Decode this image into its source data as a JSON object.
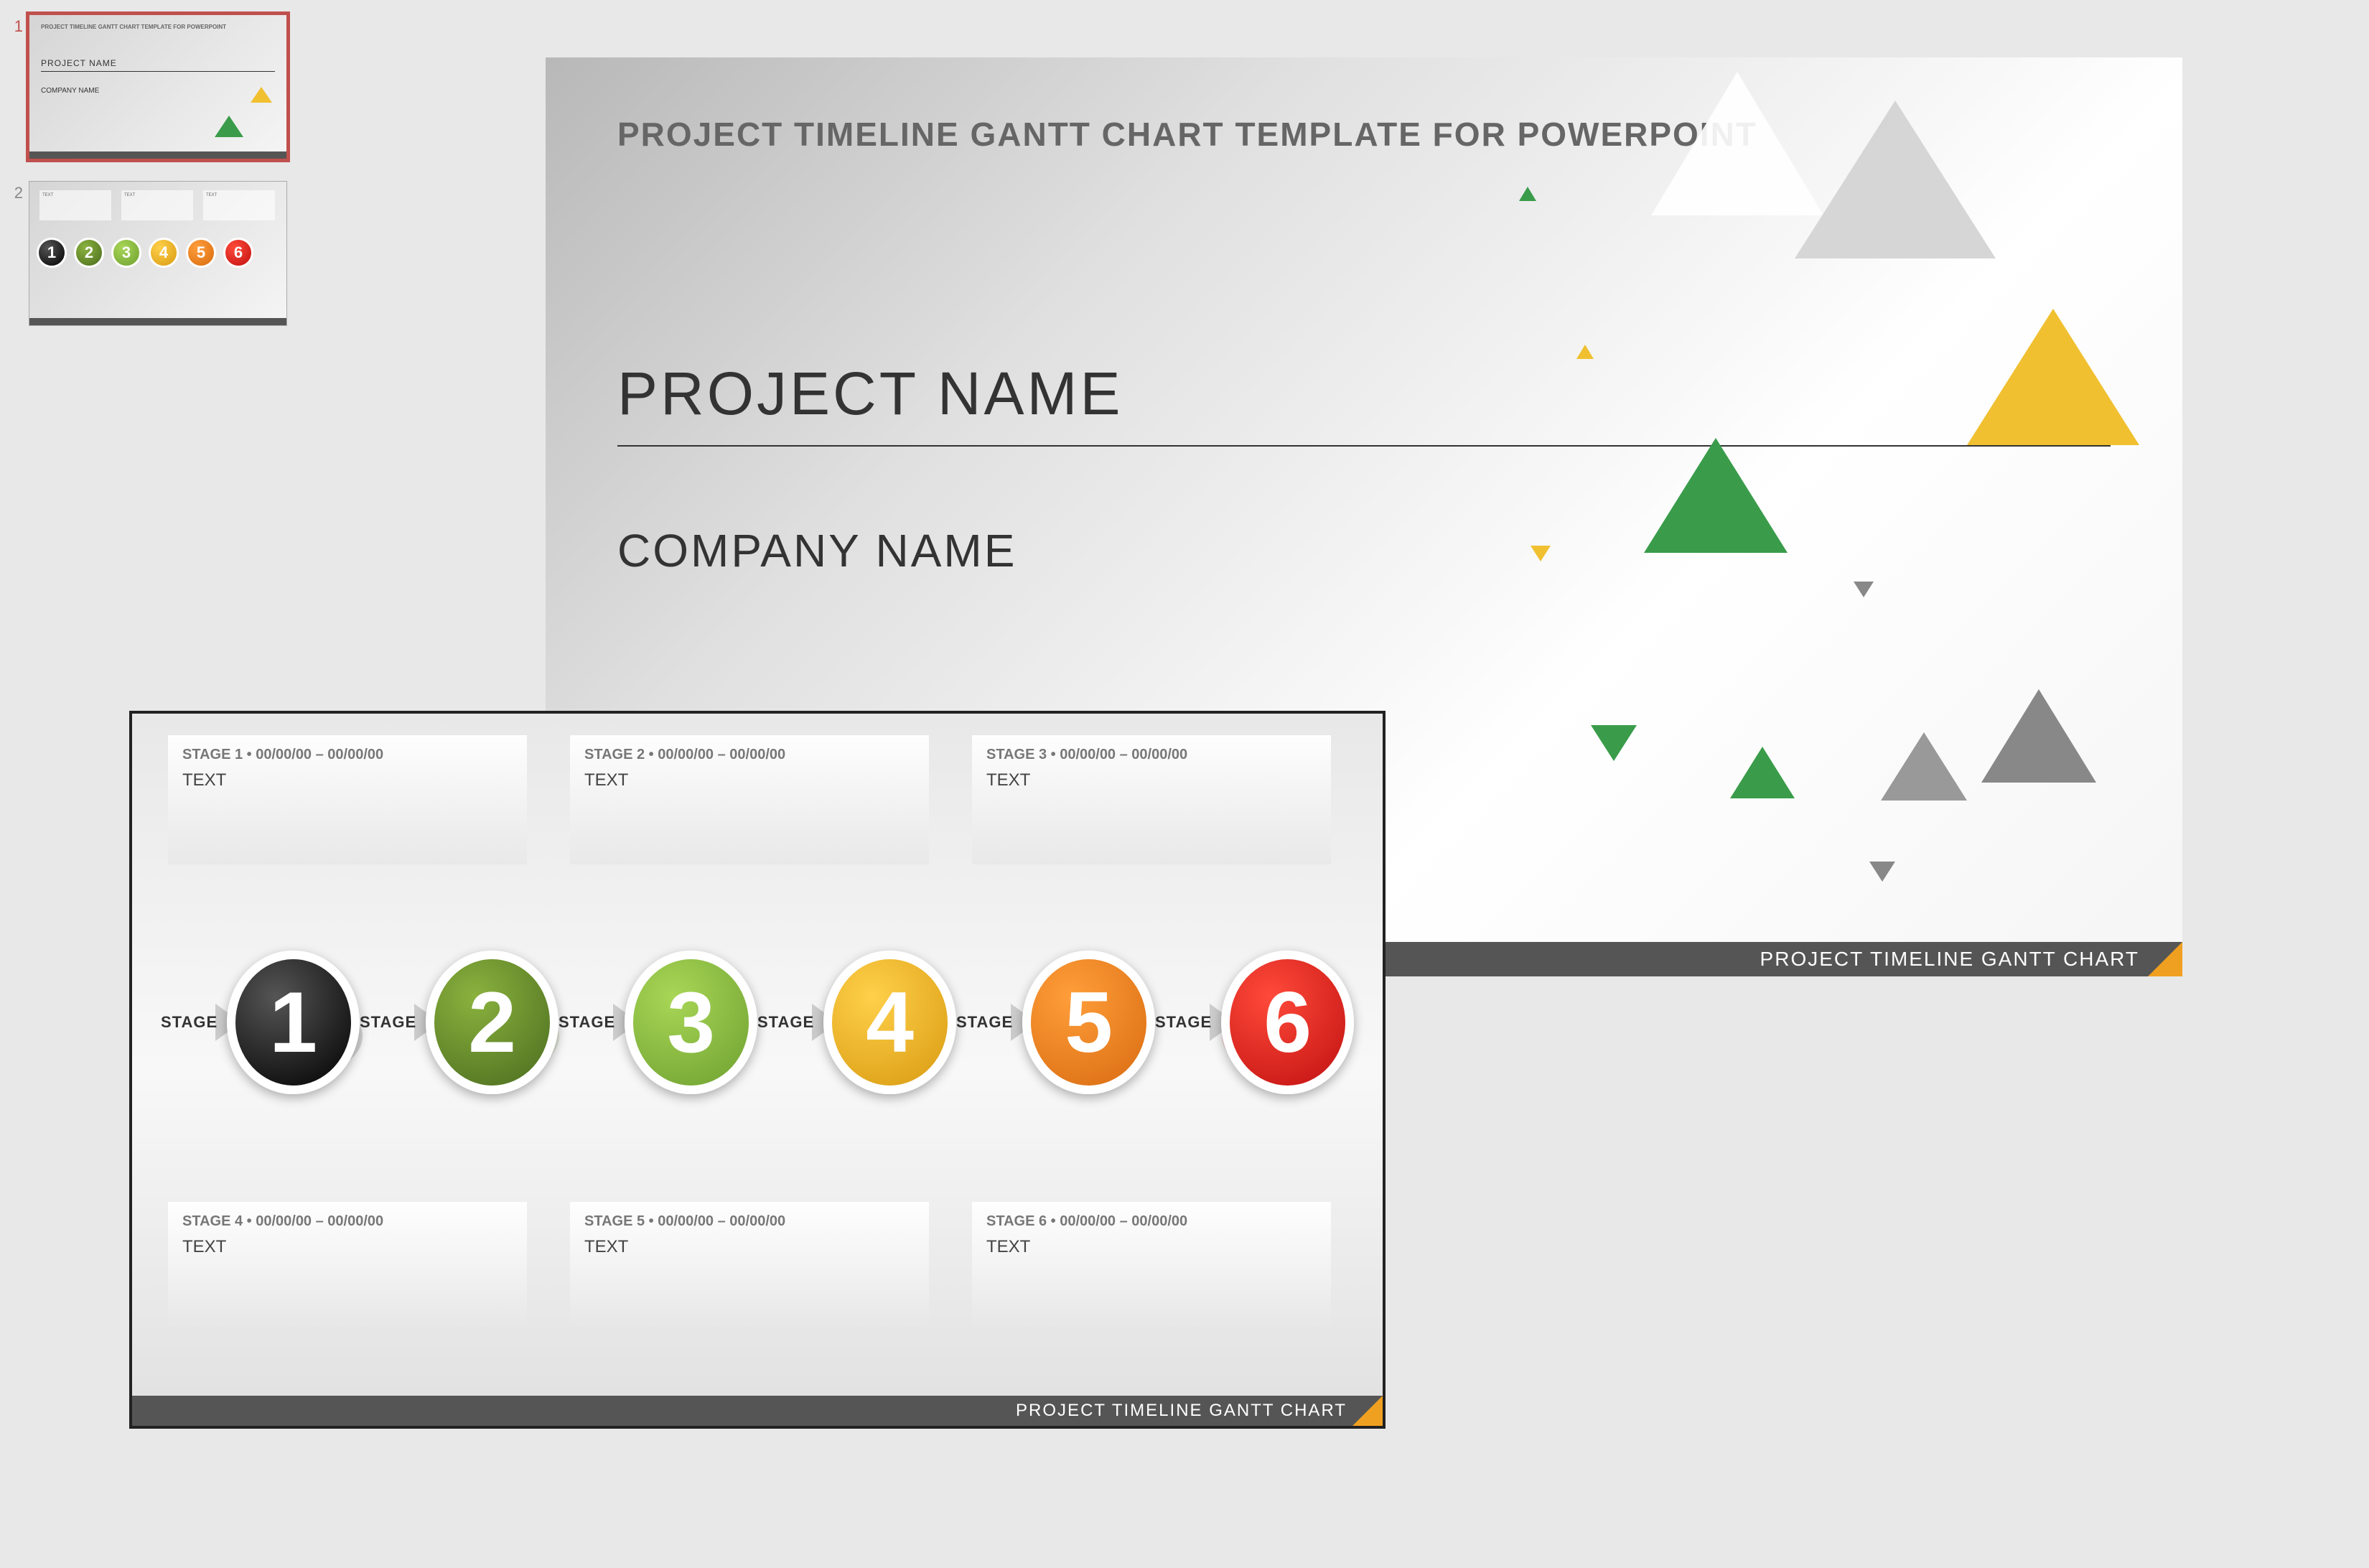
{
  "thumbnails": {
    "n1": "1",
    "n2": "2"
  },
  "slide1": {
    "title": "PROJECT TIMELINE GANTT CHART TEMPLATE FOR POWERPOINT",
    "project": "PROJECT NAME",
    "company": "COMPANY NAME",
    "footer": "PROJECT TIMELINE GANTT CHART"
  },
  "slide2": {
    "footer": "PROJECT TIMELINE GANTT CHART",
    "arrow_label": "STAGE",
    "stages": [
      {
        "label": "STAGE 1 • 00/00/00 – 00/00/00",
        "text": "TEXT",
        "num": "1",
        "color": "c1"
      },
      {
        "label": "STAGE 2 • 00/00/00 – 00/00/00",
        "text": "TEXT",
        "num": "2",
        "color": "c2"
      },
      {
        "label": "STAGE 3 • 00/00/00 – 00/00/00",
        "text": "TEXT",
        "num": "3",
        "color": "c3"
      },
      {
        "label": "STAGE 4 • 00/00/00 – 00/00/00",
        "text": "TEXT",
        "num": "4",
        "color": "c4"
      },
      {
        "label": "STAGE 5 • 00/00/00 – 00/00/00",
        "text": "TEXT",
        "num": "5",
        "color": "c5"
      },
      {
        "label": "STAGE 6 • 00/00/00 – 00/00/00",
        "text": "TEXT",
        "num": "6",
        "color": "c6"
      }
    ]
  }
}
